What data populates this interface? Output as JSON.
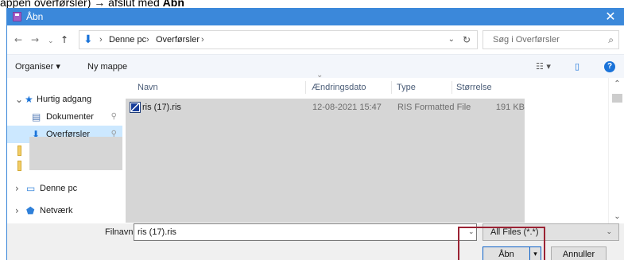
{
  "instruction": {
    "prefix": "appen overførsler)",
    "arrow": "→",
    "middle": " afslut med ",
    "bold": "Åbn"
  },
  "dialog": {
    "title": "Åbn",
    "close_icon": "close-icon",
    "colors": {
      "title_bar": "#3b88da",
      "selected_nav": "#cce8ff",
      "redaction": "#d6d6d6",
      "highlight": "#9b2334"
    }
  },
  "address_bar": {
    "crumbs": [
      "Denne pc",
      "Overførsler"
    ],
    "search_placeholder": "Søg i Overførsler"
  },
  "command_bar": {
    "organize": "Organiser",
    "new_folder": "Ny mappe"
  },
  "navigation": {
    "items": [
      {
        "label": "Hurtig adgang"
      },
      {
        "label": "Dokumenter"
      },
      {
        "label": "Overførsler"
      },
      {
        "label": "Denne pc"
      },
      {
        "label": "Netværk"
      }
    ]
  },
  "file_list": {
    "columns": [
      "Navn",
      "Ændringsdato",
      "Type",
      "Størrelse"
    ],
    "rows": [
      {
        "name": "ris (17).ris",
        "date": "12-08-2021 15:47",
        "type": "RIS Formatted File",
        "size": "191 KB"
      }
    ]
  },
  "footer": {
    "filename_label": "Filnavn:",
    "filename_value": "ris (17).ris",
    "file_type_value": "All Files (*.*)",
    "open_button": "Åbn",
    "cancel_button": "Annuller"
  }
}
